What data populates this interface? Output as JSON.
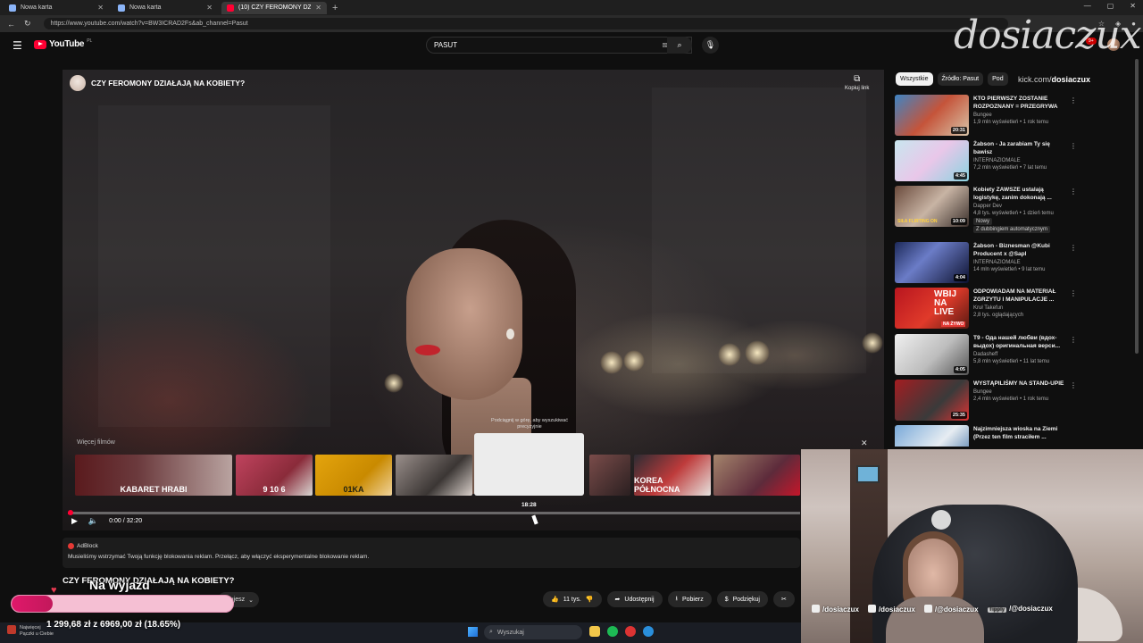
{
  "browser": {
    "tabs": [
      {
        "title": "Nowa karta",
        "active": false
      },
      {
        "title": "Nowa karta",
        "active": false
      },
      {
        "title": "(10) CZY FEROMONY DZIAŁA",
        "active": true
      }
    ],
    "url": "https://www.youtube.com/watch?v=BW3ICRAD2Fs&ab_channel=Pasut"
  },
  "youtube": {
    "logo_text": "YouTube",
    "logo_country": "PL",
    "search_value": "PASUT",
    "notif_count": "9+"
  },
  "player": {
    "overlay_title": "CZY FEROMONY DZIAŁAJĄ NA KOBIETY?",
    "copy_link_label": "Kopiuj link",
    "more_videos_label": "Więcej filmów",
    "hover_hint": "Podciągnij w górę, aby wyszukiwać precyzyjnie",
    "hover_time": "18:28",
    "time_display": "0:00 / 32:20",
    "progress_fraction": 0.005,
    "thumbnails": [
      {
        "text": "KABARET HRABI"
      },
      {
        "text": "9 10 6"
      },
      {
        "text": ""
      },
      {
        "text": "01KA"
      },
      {
        "text": ""
      },
      {
        "text": ""
      },
      {
        "text": "KOREA PÓŁNOCNA"
      },
      {
        "text": ""
      }
    ]
  },
  "adblock": {
    "brand": "AdBlock",
    "message": "Musieliśmy wstrzymać Twoją funkcję blokowania reklam. Przełącz, aby włączyć eksperymentalne blokowanie reklam."
  },
  "video": {
    "title": "CZY FEROMONY DZIAŁAJĄ NA KOBIETY?",
    "subscribe_hint": "ubujesz",
    "likes": "11 tys.",
    "share": "Udostępnij",
    "download": "Pobierz",
    "thanks": "Podziękuj"
  },
  "sidebar": {
    "chips": [
      "Wszystkie",
      "Źródło: Pasut",
      "Pod"
    ],
    "items": [
      {
        "title": "KTO PIERWSZY ZOSTANIE ROZPOZNANY = PRZEGRYWA",
        "channel": "Bungee",
        "stats": "1,9 mln wyświetleń • 1 rok temu",
        "duration": "20:31",
        "extra": ""
      },
      {
        "title": "Żabson - Ja zarabiam Ty się bawisz",
        "channel": "INTERNAZIOMALE",
        "stats": "7,2 mln wyświetleń • 7 lat temu",
        "duration": "4:45",
        "extra": ""
      },
      {
        "title": "Kobiety ZAWSZE ustalają logistykę, zanim dokonają ...",
        "channel": "Dapper Dev",
        "stats": "4,8 tys. wyświetleń • 1 dzień temu",
        "duration": "10:09",
        "extra": "Nowy",
        "extra2": "Z dubbingiem automatycznym"
      },
      {
        "title": "Żabson - Biznesman @Kubi Producent x @Sapl",
        "channel": "INTERNAZIOMALE",
        "stats": "14 mln wyświetleń • 9 lat temu",
        "duration": "4:04",
        "extra": ""
      },
      {
        "title": "ODPOWIADAM NA MATERIAŁ ZGRZYTU I MANIPULACJE ...",
        "channel": "Kruł Takefun",
        "stats": "2,8 tys. oglądających",
        "duration": "",
        "extra": ""
      },
      {
        "title": "T9 - Ода нашей любви (вдох-выдох) оригинальная верси...",
        "channel": "Dadasheff",
        "stats": "5,8 mln wyświetleń • 11 lat temu",
        "duration": "4:05",
        "extra": ""
      },
      {
        "title": "WYSTĄPILIŚMY NA STAND-UPIE",
        "channel": "Bungee",
        "stats": "2,4 mln wyświetleń • 1 rok temu",
        "duration": "25:35",
        "extra": ""
      },
      {
        "title": "Najzimniejsza wioska na Ziemi (Przez ten film straciłem ...",
        "channel": "",
        "stats": "",
        "duration": "",
        "extra": ""
      }
    ],
    "thumb_text": {
      "wbij": "WBIJ NA LIVE",
      "zywo": "NA ŻYWO",
      "live": "LIVE",
      "flirting": "SIŁA FLIRTING ON"
    }
  },
  "overlay": {
    "watermark": "dosiaczux",
    "handle_prefix": "kick.com/",
    "handle": "dosiaczux"
  },
  "webcam": {
    "socials": [
      {
        "name": "instagram",
        "handle": "/dosiaczux"
      },
      {
        "name": "tiktok",
        "handle": "/dosiaczux"
      },
      {
        "name": "threads",
        "handle": "/@dosiaczux"
      },
      {
        "name": "tippy",
        "label": "Tipply",
        "handle": "/@dosiaczux"
      }
    ]
  },
  "goal": {
    "title": "Na wyjazd",
    "text": "1 299,68 zł z 6969,00 zł (18.65%)",
    "fraction": 0.1865
  },
  "taskbar": {
    "weather_line1": "Najwięcej",
    "weather_line2": "Pączki u Ciebie",
    "search_placeholder": "Wyszukaj"
  },
  "colors": {
    "accent": "#ff0033",
    "goal_fill": "#e0186a",
    "goal_bg": "#f5bfd3"
  }
}
